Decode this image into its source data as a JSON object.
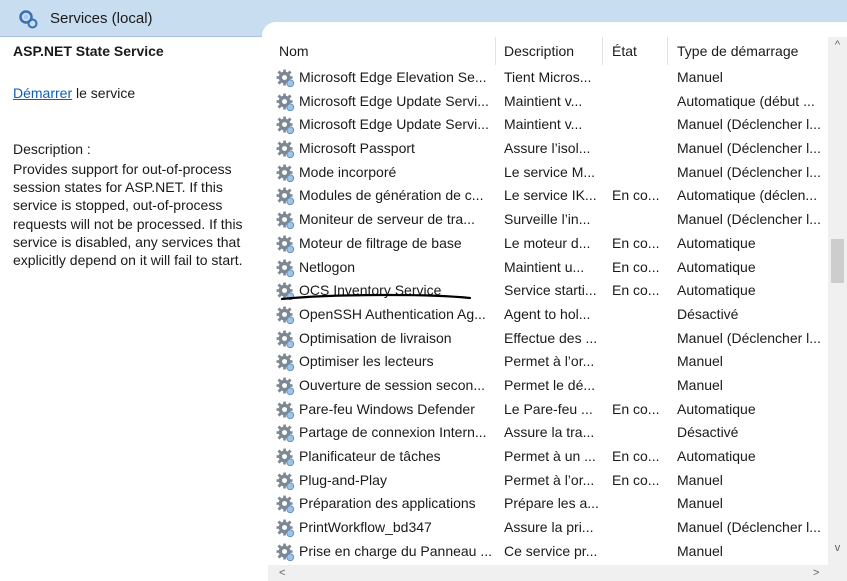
{
  "header": {
    "title": "Services (local)"
  },
  "details": {
    "service_name": "ASP.NET State Service",
    "start_link": "Démarrer",
    "start_suffix": " le service",
    "description_label": "Description :",
    "description": "Provides support for out-of-process session states for ASP.NET. If this service is stopped, out-of-process requests will not be processed. If this service is disabled, any services that explicitly depend on it will fail to start."
  },
  "table": {
    "columns": {
      "name": "Nom",
      "description": "Description",
      "etat": "État",
      "type": "Type de démarrage"
    },
    "sort_indicator": "^",
    "rows": [
      {
        "name": "Microsoft Edge Elevation Se...",
        "description": "Tient Micros...",
        "etat": "",
        "type": "Manuel"
      },
      {
        "name": "Microsoft Edge Update Servi...",
        "description": "Maintient v...",
        "etat": "",
        "type": "Automatique (début ..."
      },
      {
        "name": "Microsoft Edge Update Servi...",
        "description": "Maintient v...",
        "etat": "",
        "type": "Manuel (Déclencher l..."
      },
      {
        "name": "Microsoft Passport",
        "description": "Assure l’isol...",
        "etat": "",
        "type": "Manuel (Déclencher l..."
      },
      {
        "name": "Mode incorporé",
        "description": "Le service M...",
        "etat": "",
        "type": "Manuel (Déclencher l..."
      },
      {
        "name": "Modules de génération de c...",
        "description": "Le service IK...",
        "etat": "En co...",
        "type": "Automatique (déclen..."
      },
      {
        "name": "Moniteur de serveur de tra...",
        "description": "Surveille l’in...",
        "etat": "",
        "type": "Manuel (Déclencher l..."
      },
      {
        "name": "Moteur de filtrage de base",
        "description": "Le moteur d...",
        "etat": "En co...",
        "type": "Automatique"
      },
      {
        "name": "Netlogon",
        "description": "Maintient u...",
        "etat": "En co...",
        "type": "Automatique"
      },
      {
        "name": "OCS Inventory Service",
        "description": "Service starti...",
        "etat": "En co...",
        "type": "Automatique"
      },
      {
        "name": "OpenSSH Authentication Ag...",
        "description": "Agent to hol...",
        "etat": "",
        "type": "Désactivé"
      },
      {
        "name": "Optimisation de livraison",
        "description": "Effectue des ...",
        "etat": "",
        "type": "Manuel (Déclencher l..."
      },
      {
        "name": "Optimiser les lecteurs",
        "description": "Permet à l’or...",
        "etat": "",
        "type": "Manuel"
      },
      {
        "name": "Ouverture de session secon...",
        "description": "Permet le dé...",
        "etat": "",
        "type": "Manuel"
      },
      {
        "name": "Pare-feu Windows Defender",
        "description": "Le Pare-feu ...",
        "etat": "En co...",
        "type": "Automatique"
      },
      {
        "name": "Partage de connexion Intern...",
        "description": "Assure la tra...",
        "etat": "",
        "type": "Désactivé"
      },
      {
        "name": "Planificateur de tâches",
        "description": "Permet à un ...",
        "etat": "En co...",
        "type": "Automatique"
      },
      {
        "name": "Plug-and-Play",
        "description": "Permet à l’or...",
        "etat": "En co...",
        "type": "Manuel"
      },
      {
        "name": "Préparation des applications",
        "description": "Prépare les a...",
        "etat": "",
        "type": "Manuel"
      },
      {
        "name": "PrintWorkflow_bd347",
        "description": "Assure la pri...",
        "etat": "",
        "type": "Manuel (Déclencher l..."
      },
      {
        "name": "Prise en charge du Panneau ...",
        "description": "Ce service pr...",
        "etat": "",
        "type": "Manuel"
      }
    ]
  },
  "scrollbars": {
    "up": "^",
    "down": "v",
    "left": "<",
    "right": ">"
  },
  "icons": {
    "header": "services-icon",
    "row": "gear-icon"
  },
  "colors": {
    "header_bg": "#c8ddf0",
    "link": "#0b5fb5",
    "annotation": "#000000"
  }
}
